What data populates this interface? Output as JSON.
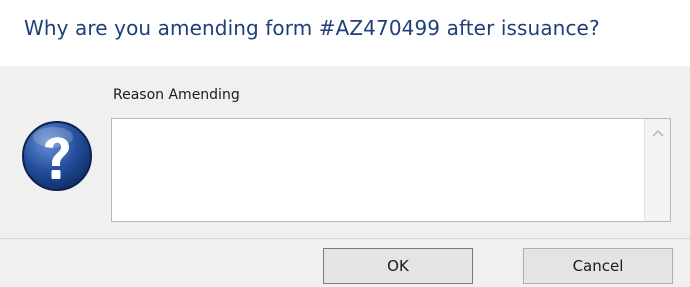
{
  "dialog": {
    "title": "Why are you amending form #AZ470499 after issuance?",
    "field_label": "Reason Amending",
    "reason_value": "",
    "icon": "question-icon",
    "accent_color": "#1f3f7a"
  },
  "buttons": {
    "ok_label": "OK",
    "cancel_label": "Cancel"
  }
}
